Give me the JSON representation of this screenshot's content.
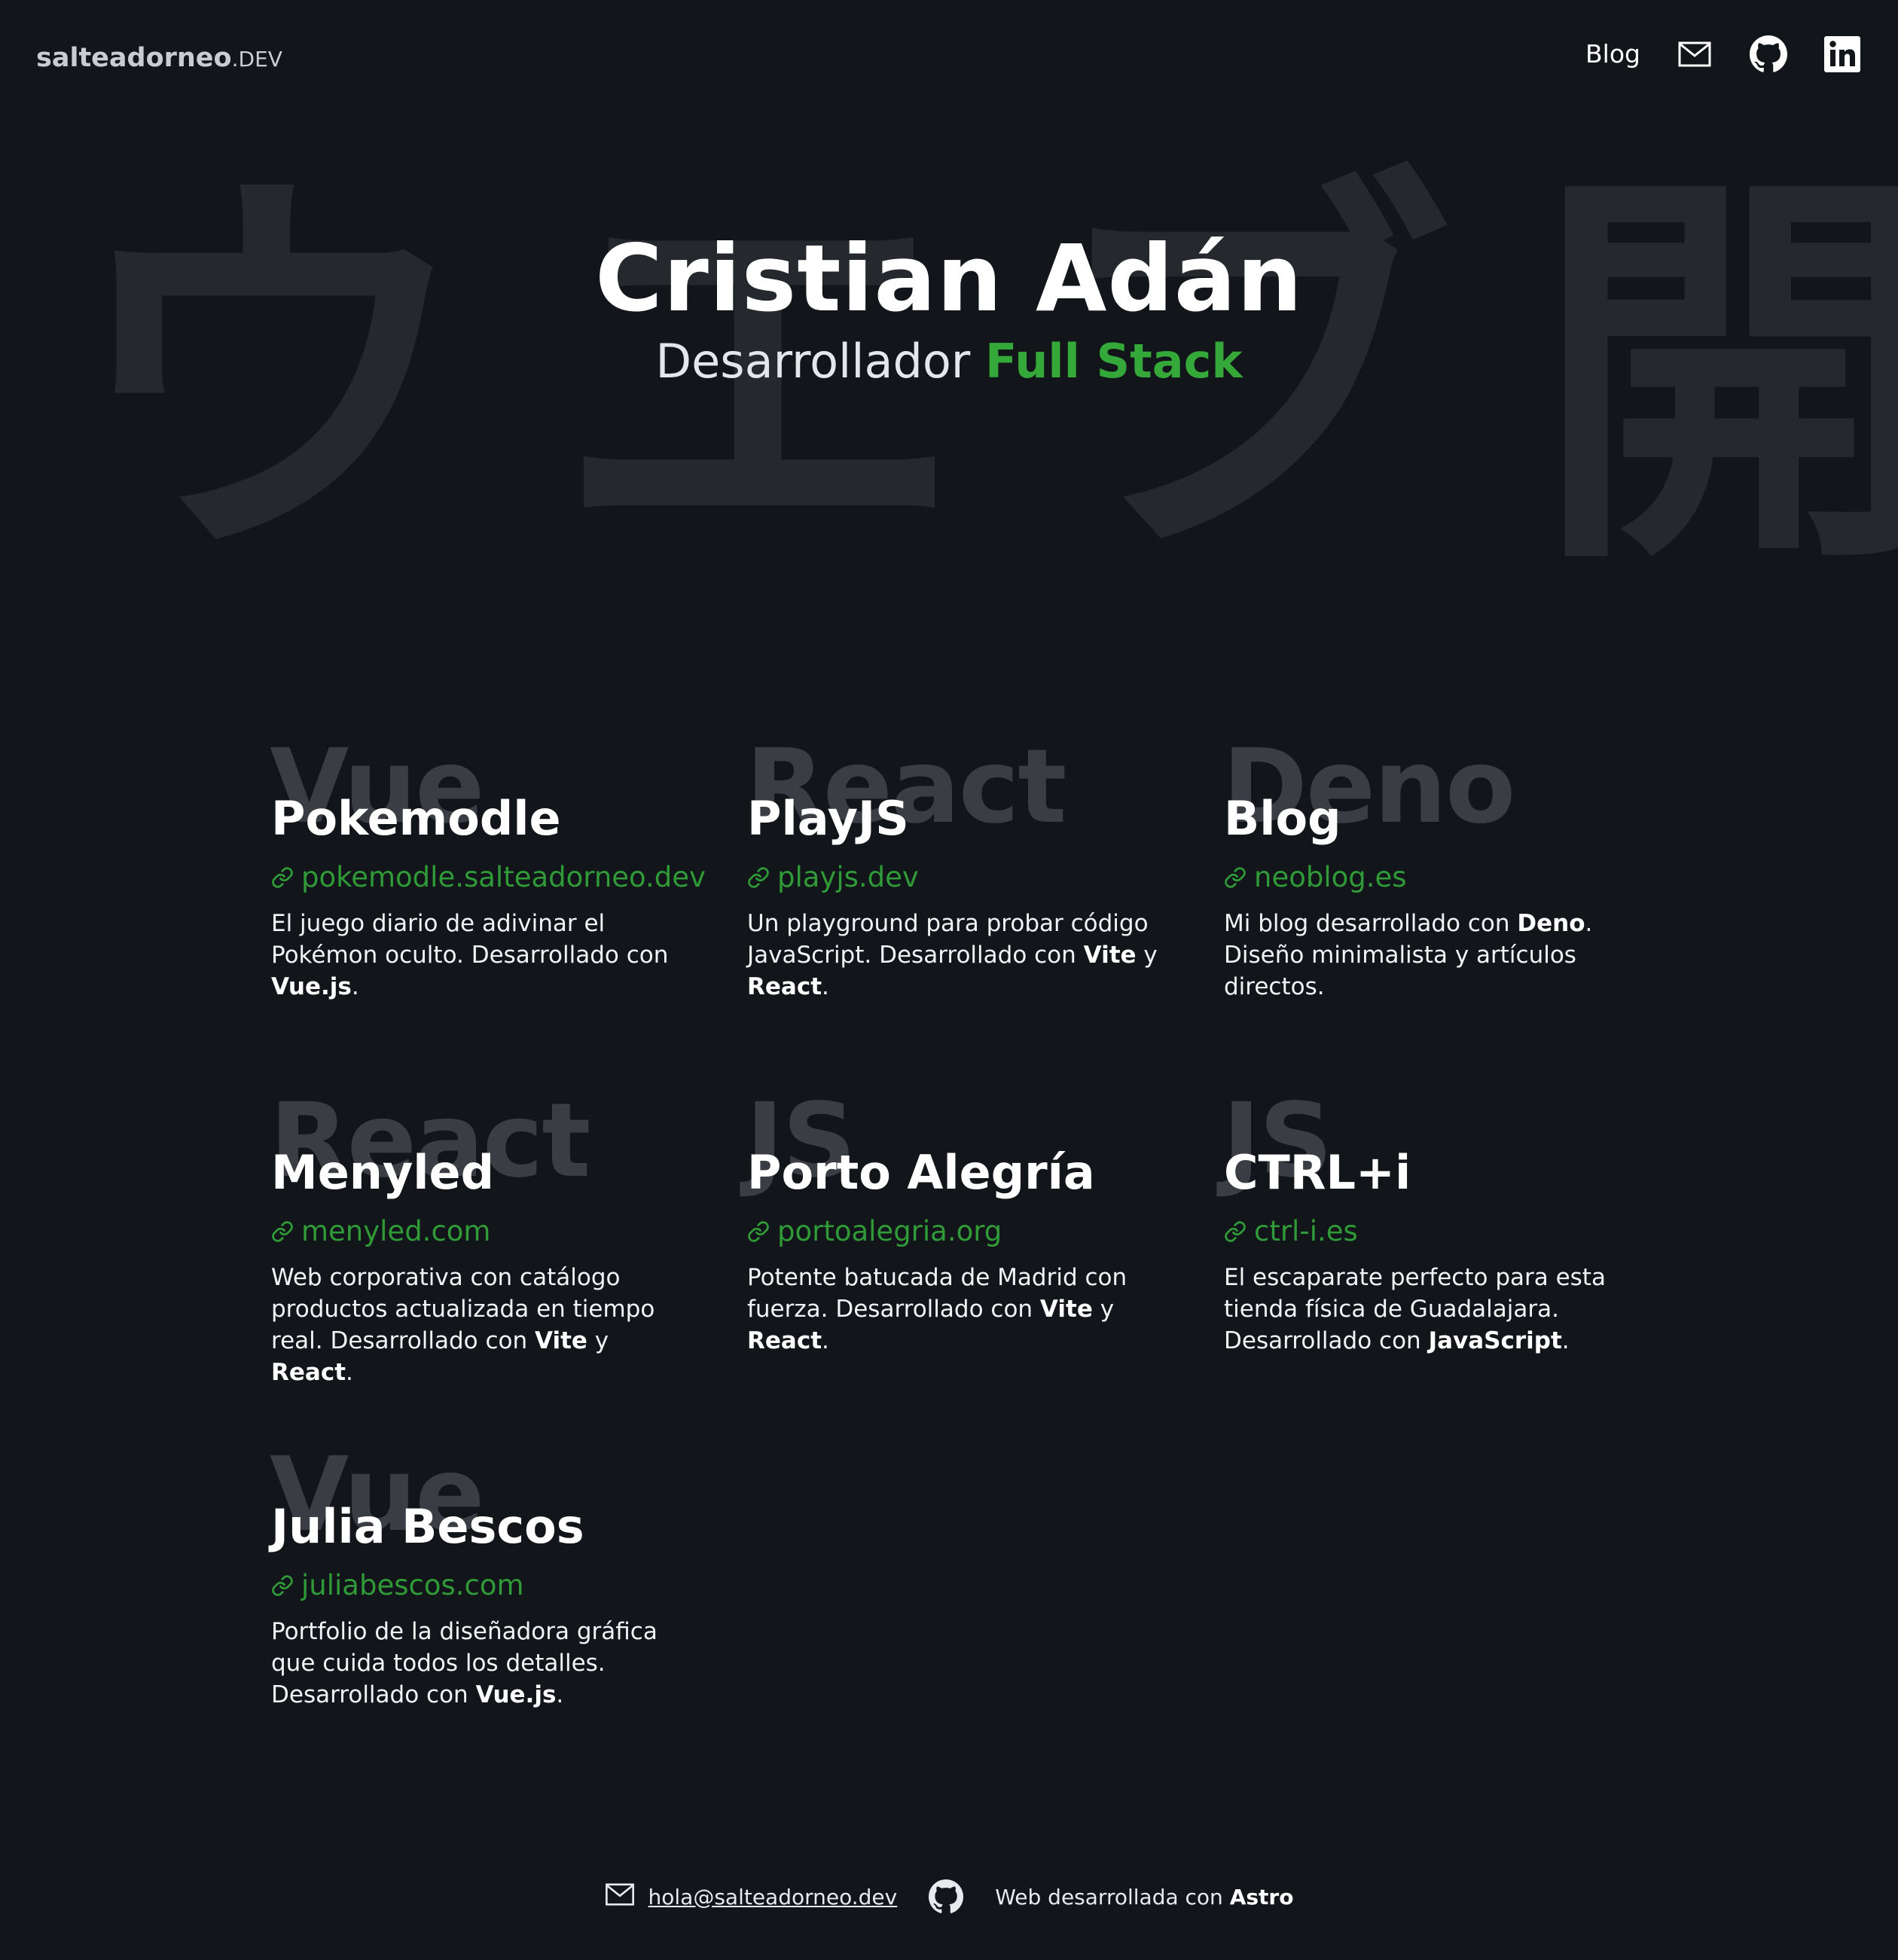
{
  "header": {
    "logo_main": "salteadorneo",
    "logo_tld": ".DEV",
    "nav": {
      "blog_label": "Blog",
      "mail_icon": "mail-icon",
      "github_icon": "github-icon",
      "linkedin_icon": "linkedin-icon"
    }
  },
  "hero": {
    "background_glyphs": [
      "ウ",
      "エ",
      "ブ",
      "開"
    ],
    "name": "Cristian Adán",
    "role_prefix": "Desarrollador ",
    "role_accent": "Full Stack"
  },
  "colors": {
    "background": "#121519",
    "accent": "#35a83a",
    "link": "#2f9a37",
    "watermark": "#3a3e44"
  },
  "projects": [
    {
      "tech": "Vue",
      "title": "Pokemodle",
      "link": "pokemodle.salteadorneo.dev",
      "desc": [
        "El juego diario de adivinar el Pokémon oculto. Desarrollado con ",
        "Vue.js",
        "."
      ]
    },
    {
      "tech": "React",
      "title": "PlayJS",
      "link": "playjs.dev",
      "desc": [
        "Un playground para probar código JavaScript. Desarrollado con ",
        "Vite",
        " y ",
        "React",
        "."
      ]
    },
    {
      "tech": "Deno",
      "title": "Blog",
      "link": "neoblog.es",
      "desc": [
        "Mi blog desarrollado con ",
        "Deno",
        ". Diseño minimalista y artículos directos."
      ]
    },
    {
      "tech": "React",
      "title": "Menyled",
      "link": "menyled.com",
      "desc": [
        "Web corporativa con catálogo productos actualizada en tiempo real. Desarrollado con ",
        "Vite",
        " y ",
        "React",
        "."
      ]
    },
    {
      "tech": "JS",
      "title": "Porto Alegría",
      "link": "portoalegria.org",
      "desc": [
        "Potente batucada de Madrid con fuerza. Desarrollado con ",
        "Vite",
        " y ",
        "React",
        "."
      ]
    },
    {
      "tech": "JS",
      "title": "CTRL+i",
      "link": "ctrl-i.es",
      "desc": [
        "El escaparate perfecto para esta tienda física de Guadalajara. Desarrollado con ",
        "JavaScript",
        "."
      ]
    },
    {
      "tech": "Vue",
      "title": "Julia Bescos",
      "link": "juliabescos.com",
      "desc": [
        "Portfolio de la diseñadora gráfica que cuida todos los detalles. Desarrollado con ",
        "Vue.js",
        "."
      ]
    }
  ],
  "footer": {
    "email": "hola@salteadorneo.dev",
    "credit_prefix": "Web desarrollada con ",
    "credit_bold": "Astro"
  }
}
